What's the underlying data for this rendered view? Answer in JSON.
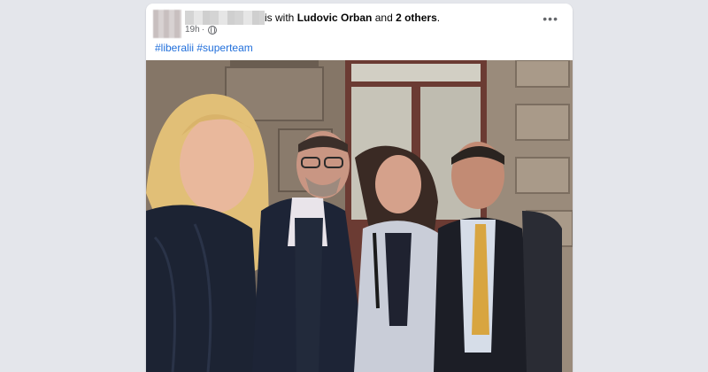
{
  "post": {
    "connector": "is with",
    "tagged_person": "Ludovic Orban",
    "and_word": "and",
    "others": "2 others",
    "period": ".",
    "time": "19h",
    "separator": "·",
    "privacy_icon": "globe-icon",
    "more_icon": "more-options-icon",
    "more_glyph": "•••",
    "hashtags": [
      "#liberalii",
      "#superteam"
    ]
  },
  "colors": {
    "page_bg": "#e4e6eb",
    "card_bg": "#ffffff",
    "link": "#216fdb",
    "meta_text": "#65676b"
  }
}
